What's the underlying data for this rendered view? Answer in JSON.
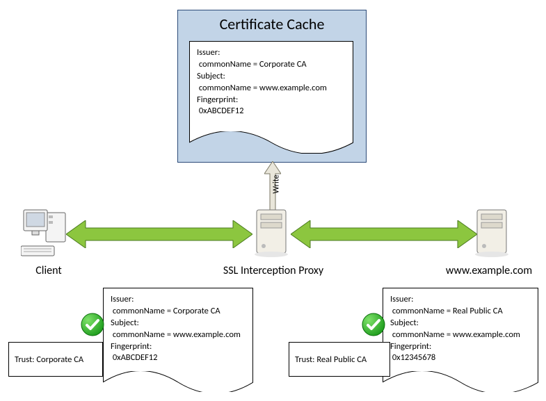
{
  "cache": {
    "title": "Certificate Cache",
    "cert": {
      "issuer_label": "Issuer:",
      "issuer_value": " commonName = Corporate CA",
      "subject_label": "Subject:",
      "subject_value": " commonName = www.example.com",
      "fingerprint_label": "Fingerprint:",
      "fingerprint_value": " 0xABCDEF12"
    }
  },
  "write_arrow_label": "Write",
  "nodes": {
    "client_label": "Client",
    "proxy_label": "SSL Interception Proxy",
    "server_label": "www.example.com"
  },
  "left_cert": {
    "issuer_label": "Issuer:",
    "issuer_value": " commonName = Corporate CA",
    "subject_label": "Subject:",
    "subject_value": " commonName = www.example.com",
    "fingerprint_label": "Fingerprint:",
    "fingerprint_value": " 0xABCDEF12"
  },
  "left_trust": "Trust: Corporate CA",
  "right_cert": {
    "issuer_label": "Issuer:",
    "issuer_value": " commonName = Real Public CA",
    "subject_label": "Subject:",
    "subject_value": " commonName = www.example.com",
    "fingerprint_label": "Fingerprint:",
    "fingerprint_value": " 0x12345678"
  },
  "right_trust": "Trust: Real Public CA"
}
